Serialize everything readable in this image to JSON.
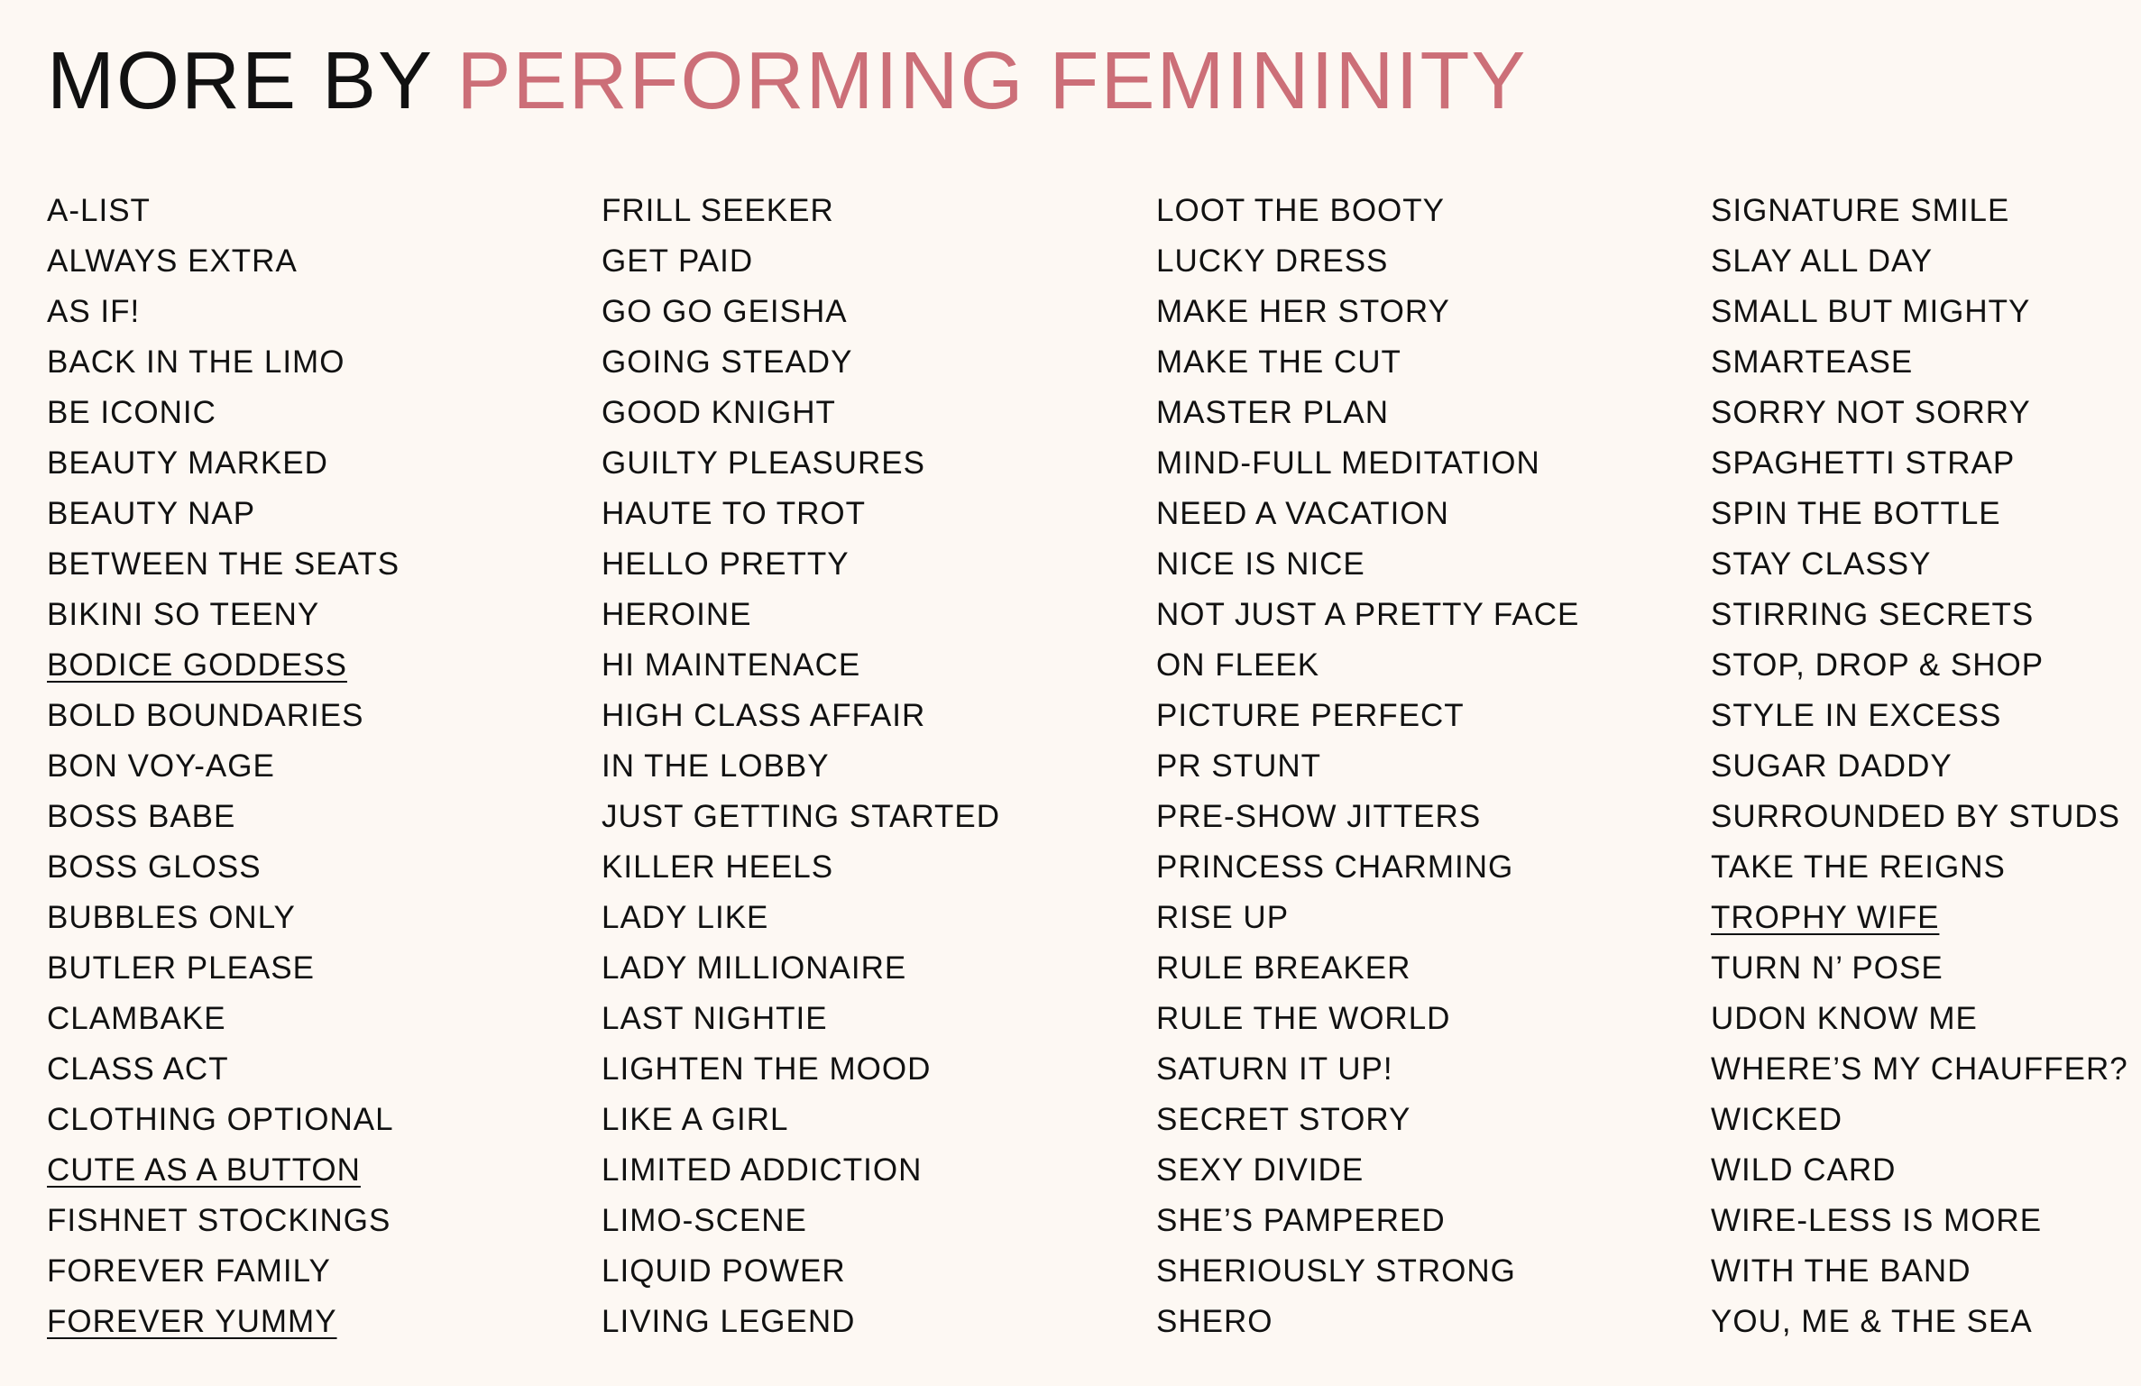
{
  "header": {
    "prefix": "MORE BY",
    "accent": "PERFORMING FEMININITY"
  },
  "colors": {
    "background": "#fdf8f3",
    "text": "#111111",
    "accent": "#cc6f78"
  },
  "columns": [
    {
      "items": [
        {
          "label": "A-LIST",
          "linked": false
        },
        {
          "label": "ALWAYS EXTRA",
          "linked": false
        },
        {
          "label": "AS IF!",
          "linked": false
        },
        {
          "label": "BACK IN THE LIMO",
          "linked": false
        },
        {
          "label": "BE ICONIC",
          "linked": false
        },
        {
          "label": "BEAUTY MARKED",
          "linked": false
        },
        {
          "label": "BEAUTY NAP",
          "linked": false
        },
        {
          "label": "BETWEEN THE SEATS",
          "linked": false
        },
        {
          "label": "BIKINI SO TEENY",
          "linked": false
        },
        {
          "label": "BODICE GODDESS",
          "linked": true
        },
        {
          "label": "BOLD BOUNDARIES",
          "linked": false
        },
        {
          "label": "BON VOY-AGE",
          "linked": false
        },
        {
          "label": "BOSS BABE",
          "linked": false
        },
        {
          "label": "BOSS GLOSS",
          "linked": false
        },
        {
          "label": "BUBBLES ONLY",
          "linked": false
        },
        {
          "label": "BUTLER PLEASE",
          "linked": false
        },
        {
          "label": "CLAMBAKE",
          "linked": false
        },
        {
          "label": "CLASS ACT",
          "linked": false
        },
        {
          "label": "CLOTHING OPTIONAL",
          "linked": false
        },
        {
          "label": "CUTE AS A BUTTON",
          "linked": true
        },
        {
          "label": "FISHNET STOCKINGS",
          "linked": false
        },
        {
          "label": "FOREVER FAMILY",
          "linked": false
        },
        {
          "label": "FOREVER YUMMY",
          "linked": true
        }
      ]
    },
    {
      "items": [
        {
          "label": "FRILL SEEKER",
          "linked": false
        },
        {
          "label": "GET PAID",
          "linked": false
        },
        {
          "label": "GO GO GEISHA",
          "linked": false
        },
        {
          "label": "GOING STEADY",
          "linked": false
        },
        {
          "label": "GOOD KNIGHT",
          "linked": false
        },
        {
          "label": "GUILTY PLEASURES",
          "linked": false
        },
        {
          "label": "HAUTE TO TROT",
          "linked": false
        },
        {
          "label": "HELLO PRETTY",
          "linked": false
        },
        {
          "label": "HEROINE",
          "linked": false
        },
        {
          "label": "HI MAINTENACE",
          "linked": false
        },
        {
          "label": "HIGH CLASS AFFAIR",
          "linked": false
        },
        {
          "label": "IN THE LOBBY",
          "linked": false
        },
        {
          "label": "JUST GETTING STARTED",
          "linked": false
        },
        {
          "label": "KILLER HEELS",
          "linked": false
        },
        {
          "label": "LADY LIKE",
          "linked": false
        },
        {
          "label": "LADY MILLIONAIRE",
          "linked": false
        },
        {
          "label": "LAST NIGHTIE",
          "linked": false
        },
        {
          "label": "LIGHTEN THE MOOD",
          "linked": false
        },
        {
          "label": "LIKE A GIRL",
          "linked": false
        },
        {
          "label": "LIMITED ADDICTION",
          "linked": false
        },
        {
          "label": "LIMO-SCENE",
          "linked": false
        },
        {
          "label": "LIQUID POWER",
          "linked": false
        },
        {
          "label": "LIVING LEGEND",
          "linked": false
        }
      ]
    },
    {
      "items": [
        {
          "label": "LOOT THE BOOTY",
          "linked": false
        },
        {
          "label": "LUCKY DRESS",
          "linked": false
        },
        {
          "label": "MAKE HER STORY",
          "linked": false
        },
        {
          "label": "MAKE THE CUT",
          "linked": false
        },
        {
          "label": "MASTER PLAN",
          "linked": false
        },
        {
          "label": "MIND-FULL MEDITATION",
          "linked": false
        },
        {
          "label": "NEED A VACATION",
          "linked": false
        },
        {
          "label": "NICE IS NICE",
          "linked": false
        },
        {
          "label": "NOT JUST A PRETTY FACE",
          "linked": false
        },
        {
          "label": "ON FLEEK",
          "linked": false
        },
        {
          "label": "PICTURE PERFECT",
          "linked": false
        },
        {
          "label": "PR STUNT",
          "linked": false
        },
        {
          "label": "PRE-SHOW JITTERS",
          "linked": false
        },
        {
          "label": "PRINCESS CHARMING",
          "linked": false
        },
        {
          "label": "RISE UP",
          "linked": false
        },
        {
          "label": "RULE BREAKER",
          "linked": false
        },
        {
          "label": "RULE THE WORLD",
          "linked": false
        },
        {
          "label": "SATURN IT UP!",
          "linked": false
        },
        {
          "label": "SECRET STORY",
          "linked": false
        },
        {
          "label": "SEXY DIVIDE",
          "linked": false
        },
        {
          "label": "SHE’S PAMPERED",
          "linked": false
        },
        {
          "label": "SHERIOUSLY STRONG",
          "linked": false
        },
        {
          "label": "SHERO",
          "linked": false
        }
      ]
    },
    {
      "items": [
        {
          "label": "SIGNATURE SMILE",
          "linked": false
        },
        {
          "label": "SLAY ALL DAY",
          "linked": false
        },
        {
          "label": "SMALL BUT MIGHTY",
          "linked": false
        },
        {
          "label": "SMARTEASE",
          "linked": false
        },
        {
          "label": "SORRY NOT SORRY",
          "linked": false
        },
        {
          "label": "SPAGHETTI STRAP",
          "linked": false
        },
        {
          "label": "SPIN THE BOTTLE",
          "linked": false
        },
        {
          "label": "STAY CLASSY",
          "linked": false
        },
        {
          "label": "STIRRING SECRETS",
          "linked": false
        },
        {
          "label": "STOP, DROP & SHOP",
          "linked": false
        },
        {
          "label": "STYLE IN EXCESS",
          "linked": false
        },
        {
          "label": "SUGAR DADDY",
          "linked": false
        },
        {
          "label": "SURROUNDED BY STUDS",
          "linked": false
        },
        {
          "label": "TAKE THE REIGNS",
          "linked": false
        },
        {
          "label": "TROPHY WIFE",
          "linked": true
        },
        {
          "label": "TURN N’ POSE",
          "linked": false
        },
        {
          "label": "UDON KNOW ME",
          "linked": false
        },
        {
          "label": "WHERE’S MY CHAUFFER?",
          "linked": false
        },
        {
          "label": "WICKED",
          "linked": false
        },
        {
          "label": "WILD CARD",
          "linked": false
        },
        {
          "label": "WIRE-LESS IS MORE",
          "linked": false
        },
        {
          "label": "WITH THE BAND",
          "linked": false
        },
        {
          "label": "YOU, ME & THE SEA",
          "linked": false
        }
      ]
    }
  ]
}
